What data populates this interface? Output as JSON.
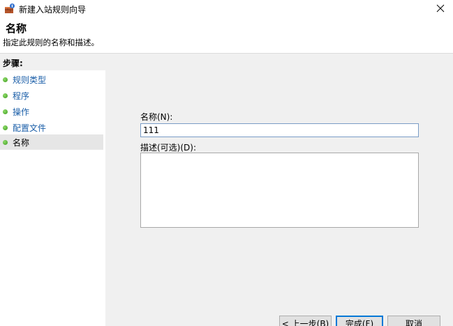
{
  "window": {
    "title": "新建入站规则向导",
    "icon": "firewall-wizard-icon"
  },
  "header": {
    "title": "名称",
    "description": "指定此规则的名称和描述。"
  },
  "steps": {
    "heading": "步骤:",
    "items": [
      {
        "label": "规则类型",
        "current": false
      },
      {
        "label": "程序",
        "current": false
      },
      {
        "label": "操作",
        "current": false
      },
      {
        "label": "配置文件",
        "current": false
      },
      {
        "label": "名称",
        "current": true
      }
    ]
  },
  "form": {
    "name_label": "名称(N):",
    "name_value": "111",
    "description_label": "描述(可选)(D):",
    "description_value": ""
  },
  "buttons": {
    "back": "< 上一步(B)",
    "finish": "完成(F)",
    "cancel": "取消"
  },
  "colors": {
    "step_link": "#1a5ea8",
    "step_dot": "#3e9b1f",
    "content_bg": "#f0f0f0",
    "focus_border": "#0078d7"
  }
}
